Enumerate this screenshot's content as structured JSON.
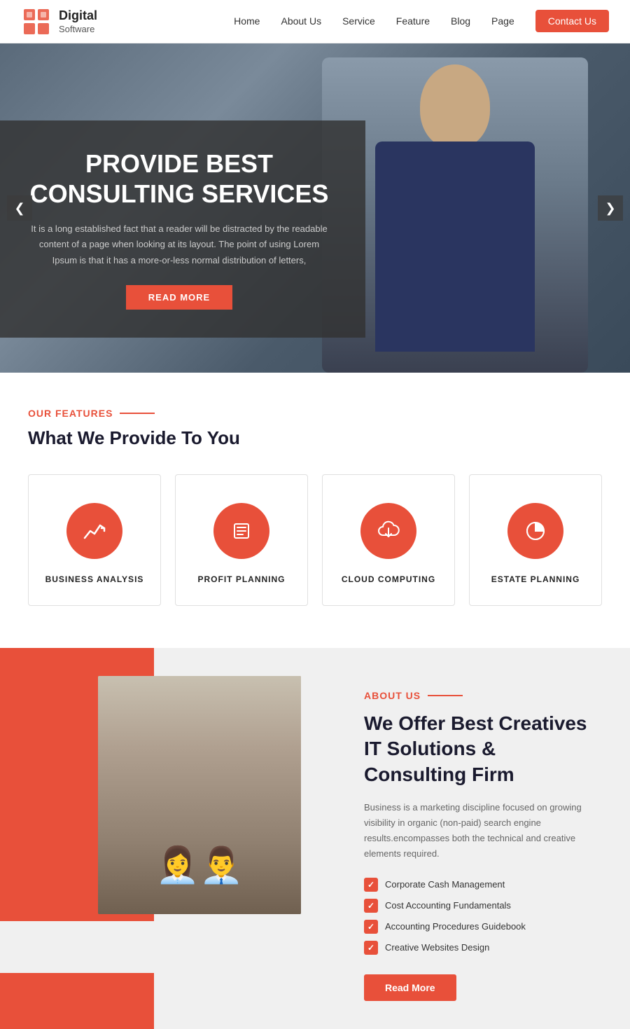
{
  "navbar": {
    "brand_name": "Digital",
    "brand_sub": "Software",
    "links": [
      {
        "id": "home",
        "label": "Home"
      },
      {
        "id": "about",
        "label": "About Us"
      },
      {
        "id": "service",
        "label": "Service"
      },
      {
        "id": "feature",
        "label": "Feature"
      },
      {
        "id": "blog",
        "label": "Blog"
      },
      {
        "id": "page",
        "label": "Page"
      }
    ],
    "contact_label": "Contact Us"
  },
  "hero": {
    "title_line1": "PROVIDE BEST",
    "title_line2": "CONSULTING SERVICES",
    "description": "It is a long established fact that a reader will be distracted by the readable content of a page when looking at its layout. The point of using Lorem Ipsum is that it has a more-or-less normal distribution of letters,",
    "button_label": "READ MORE",
    "arrow_left": "❮",
    "arrow_right": "❯"
  },
  "features": {
    "section_label": "OUR FEATURES",
    "section_title": "What We Provide To You",
    "cards": [
      {
        "id": "business-analysis",
        "label": "BUSINESS ANALYSIS",
        "icon": "chart"
      },
      {
        "id": "profit-planning",
        "label": "PROFIT PLANNING",
        "icon": "list"
      },
      {
        "id": "cloud-computing",
        "label": "CLOUD COMPUTING",
        "icon": "cloud"
      },
      {
        "id": "estate-planning",
        "label": "ESTATE PLANNING",
        "icon": "pie"
      }
    ]
  },
  "about": {
    "section_label": "ABOUT US",
    "title": "We Offer Best Creatives IT Solutions & Consulting Firm",
    "description": "Business is a marketing discipline focused on growing visibility in organic (non-paid) search engine results.encompasses both the technical and creative elements required.",
    "checklist": [
      "Corporate Cash Management",
      "Cost Accounting Fundamentals",
      "Accounting Procedures Guidebook",
      "Creative Websites Design"
    ],
    "button_label": "Read  More"
  },
  "colors": {
    "accent": "#e8503a",
    "dark": "#1a1a2e",
    "text_muted": "#666"
  }
}
